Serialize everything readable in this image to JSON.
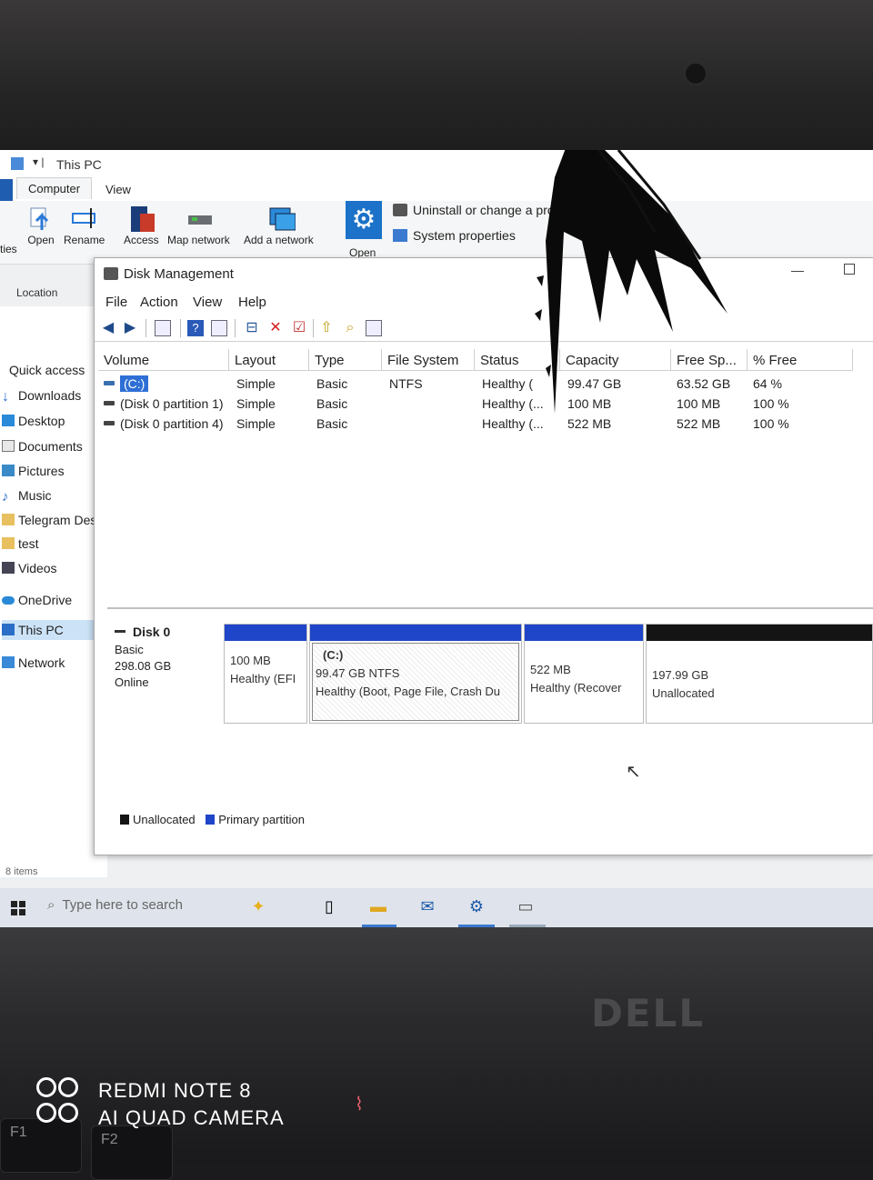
{
  "explorer": {
    "title": "This PC",
    "ribbon_tabs": [
      "Computer",
      "View"
    ],
    "ribbon_buttons": [
      "ties",
      "Open",
      "Rename",
      "Access",
      "Map network",
      "Add a network",
      "Open"
    ],
    "ribbon_links": [
      "Uninstall or change a program",
      "System properties"
    ],
    "location_group": "Location",
    "sidebar": [
      {
        "label": "Quick access",
        "icon": "star-icon"
      },
      {
        "label": "Downloads",
        "icon": "download-icon"
      },
      {
        "label": "Desktop",
        "icon": "desktop-icon"
      },
      {
        "label": "Documents",
        "icon": "document-icon"
      },
      {
        "label": "Pictures",
        "icon": "picture-icon"
      },
      {
        "label": "Music",
        "icon": "music-icon"
      },
      {
        "label": "Telegram Desl",
        "icon": "folder-icon"
      },
      {
        "label": "test",
        "icon": "folder-icon"
      },
      {
        "label": "Videos",
        "icon": "video-icon"
      },
      {
        "label": "OneDrive",
        "icon": "cloud-icon"
      },
      {
        "label": "This PC",
        "icon": "computer-icon"
      },
      {
        "label": "Network",
        "icon": "network-icon"
      }
    ],
    "status": "8 items"
  },
  "disk_management": {
    "title": "Disk Management",
    "menu": [
      "File",
      "Action",
      "View",
      "Help"
    ],
    "columns": [
      "Volume",
      "Layout",
      "Type",
      "File System",
      "Status",
      "Capacity",
      "Free Sp...",
      "% Free"
    ],
    "volumes": [
      {
        "volume": "(C:)",
        "layout": "Simple",
        "type": "Basic",
        "fs": "NTFS",
        "status": "Healthy (",
        "capacity": "99.47 GB",
        "free": "63.52 GB",
        "pct": "64 %"
      },
      {
        "volume": "(Disk 0 partition 1)",
        "layout": "Simple",
        "type": "Basic",
        "fs": "",
        "status": "Healthy (...",
        "capacity": "100 MB",
        "free": "100 MB",
        "pct": "100 %"
      },
      {
        "volume": "(Disk 0 partition 4)",
        "layout": "Simple",
        "type": "Basic",
        "fs": "",
        "status": "Healthy (...",
        "capacity": "522 MB",
        "free": "522 MB",
        "pct": "100 %"
      }
    ],
    "disk": {
      "name": "Disk 0",
      "kind": "Basic",
      "size": "298.08 GB",
      "state": "Online",
      "partitions": [
        {
          "line1": "",
          "line2": "100 MB",
          "line3": "Healthy (EFI"
        },
        {
          "line1": "(C:)",
          "line2": "99.47 GB NTFS",
          "line3": "Healthy (Boot, Page File, Crash Du"
        },
        {
          "line1": "",
          "line2": "522 MB",
          "line3": "Healthy (Recover"
        },
        {
          "line1": "",
          "line2": "197.99 GB",
          "line3": "Unallocated"
        }
      ]
    },
    "legend": [
      {
        "label": "Unallocated",
        "color": "#141414"
      },
      {
        "label": "Primary partition",
        "color": "#1f45c8"
      }
    ]
  },
  "taskbar": {
    "search_placeholder": "Type here to search"
  },
  "device": {
    "brand": "DELL",
    "keys": [
      "F1",
      "F2"
    ]
  },
  "watermark": {
    "line1": "REDMI NOTE 8",
    "line2": "AI QUAD CAMERA"
  }
}
